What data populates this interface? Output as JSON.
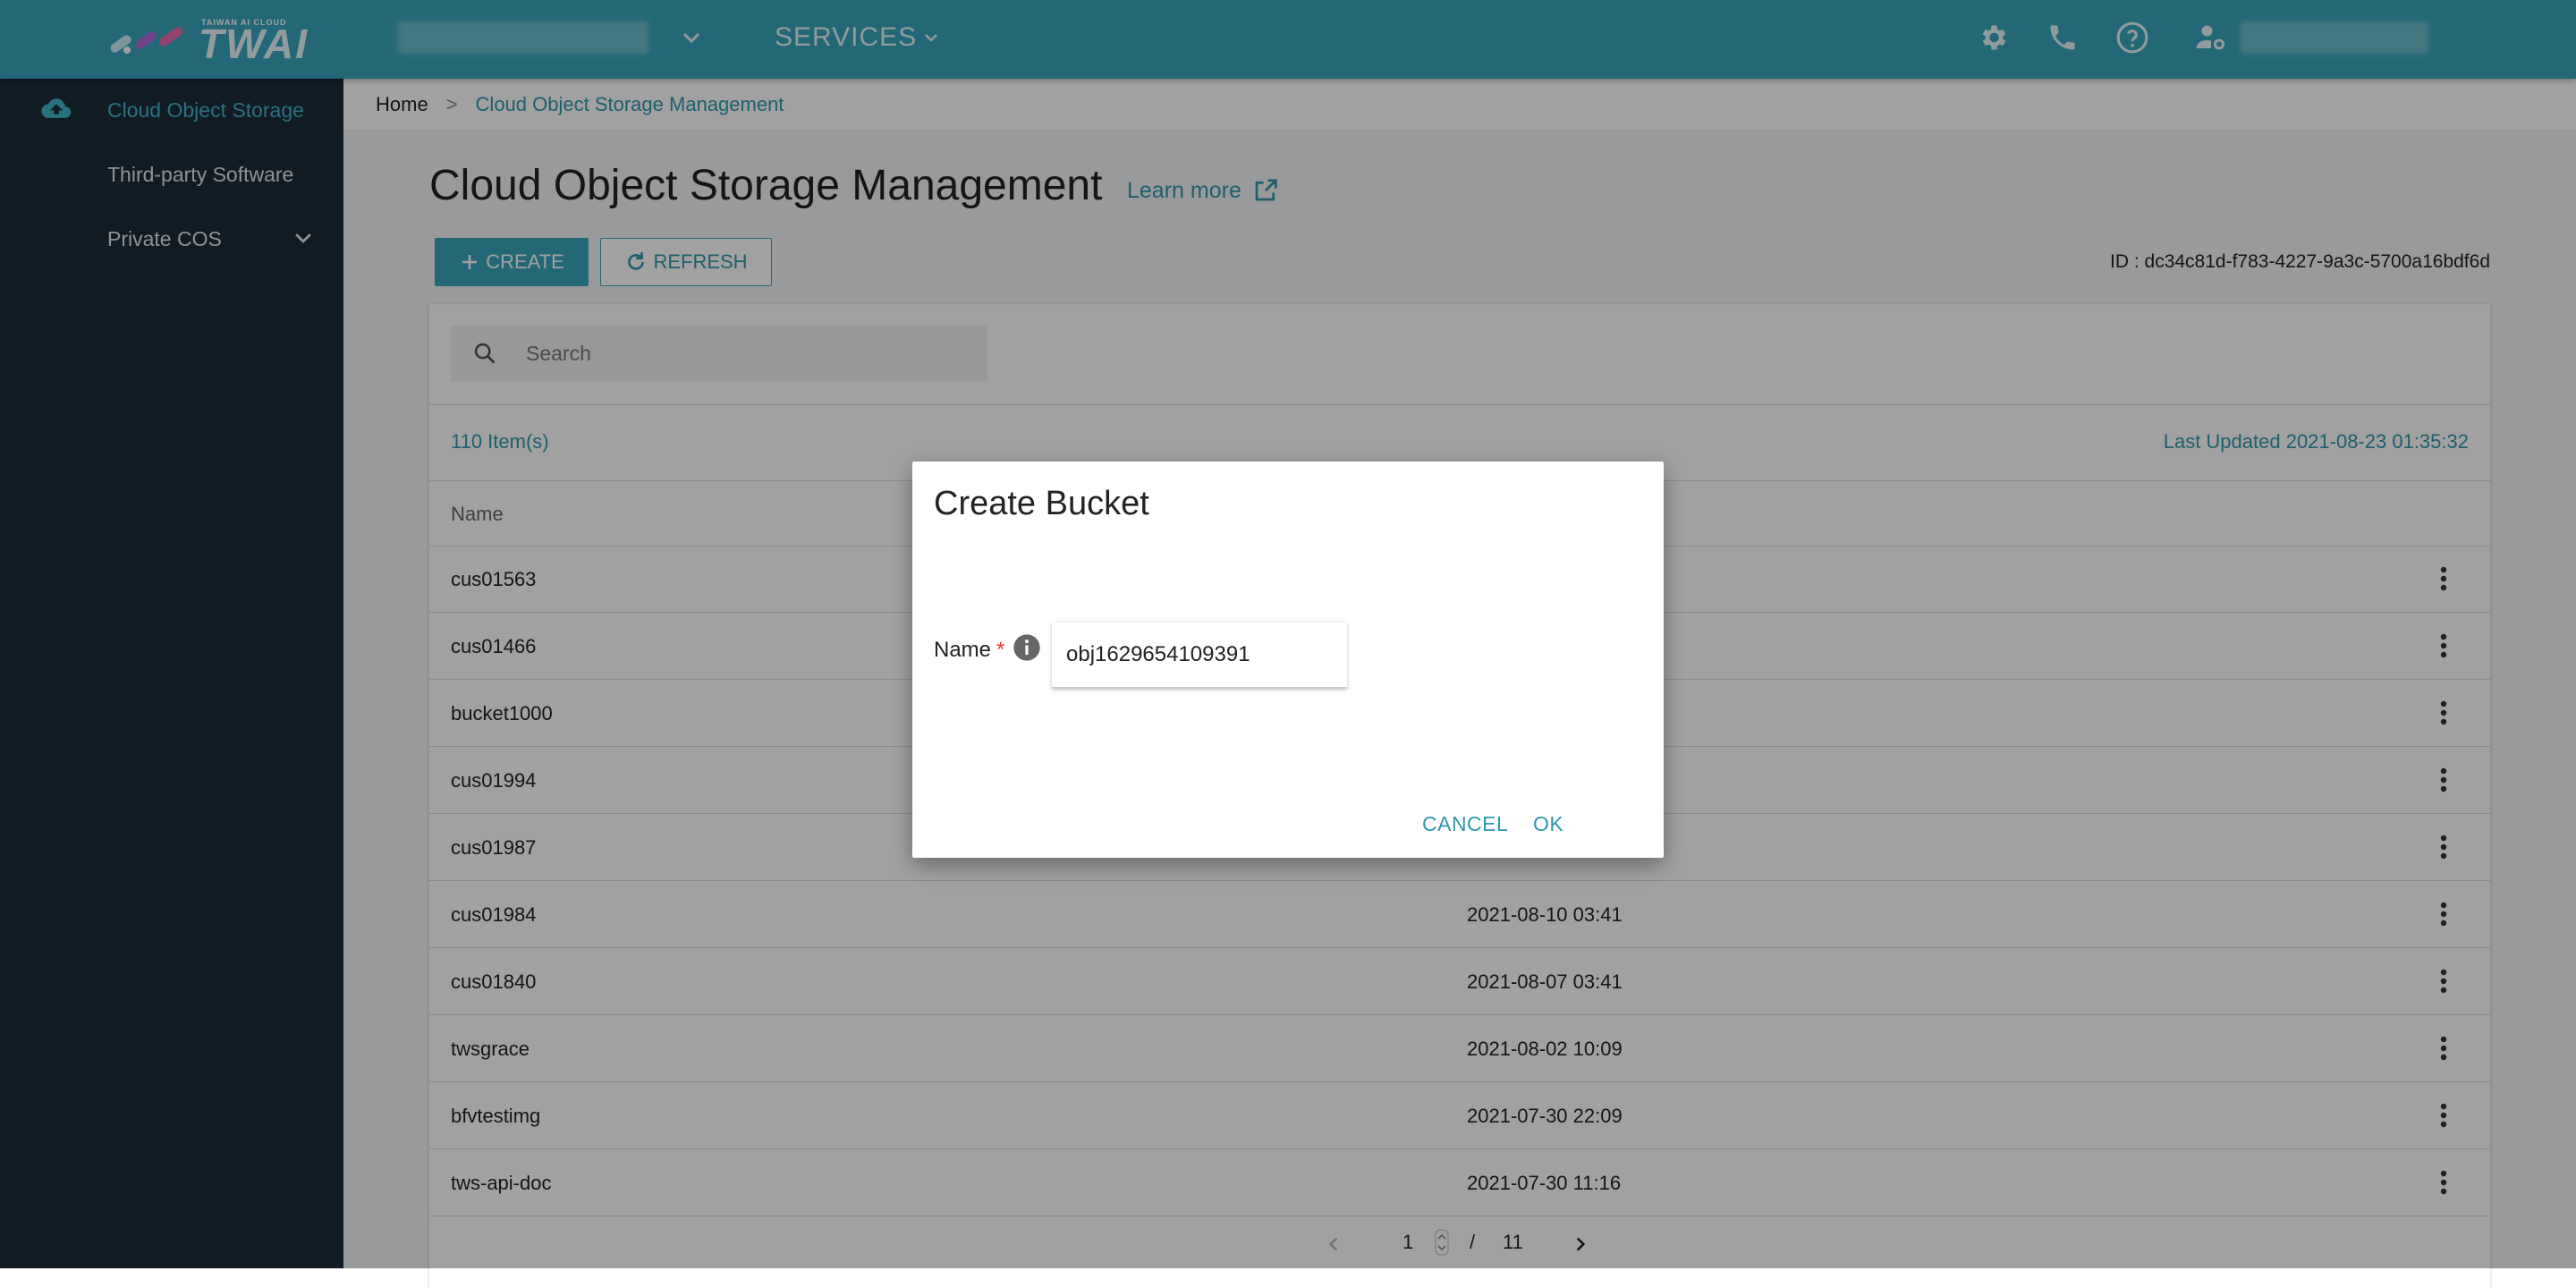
{
  "header": {
    "logo_sub": "TAIWAN AI CLOUD",
    "logo_main": "TWAI",
    "services_label": "SERVICES"
  },
  "sidebar": {
    "items": [
      {
        "label": "Cloud Object Storage",
        "active": true
      },
      {
        "label": "Third-party Software"
      },
      {
        "label": "Private COS"
      }
    ]
  },
  "breadcrumb": {
    "home": "Home",
    "separator": ">",
    "current": "Cloud Object Storage Management"
  },
  "page": {
    "title": "Cloud Object Storage Management",
    "learn_more": "Learn more",
    "create_label": "CREATE",
    "refresh_label": "REFRESH",
    "account_id": "ID : dc34c81d-f783-4227-9a3c-5700a16bdf6d"
  },
  "table": {
    "search_placeholder": "Search",
    "item_count": "110 Item(s)",
    "last_updated": "Last Updated 2021-08-23 01:35:32",
    "name_header": "Name",
    "rows": [
      {
        "name": "cus01563",
        "date": ""
      },
      {
        "name": "cus01466",
        "date": ""
      },
      {
        "name": "bucket1000",
        "date": ""
      },
      {
        "name": "cus01994",
        "date": ""
      },
      {
        "name": "cus01987",
        "date": ""
      },
      {
        "name": "cus01984",
        "date": "2021-08-10 03:41"
      },
      {
        "name": "cus01840",
        "date": "2021-08-07 03:41"
      },
      {
        "name": "twsgrace",
        "date": "2021-08-02 10:09"
      },
      {
        "name": "bfvtestimg",
        "date": "2021-07-30 22:09"
      },
      {
        "name": "tws-api-doc",
        "date": "2021-07-30 11:16"
      }
    ]
  },
  "pagination": {
    "current": "1",
    "separator": "/",
    "total": "11"
  },
  "dialog": {
    "title": "Create Bucket",
    "name_label": "Name",
    "required_mark": "*",
    "name_value": "obj1629654109391",
    "cancel_label": "CANCEL",
    "ok_label": "OK"
  },
  "colors": {
    "header": "#3aa5bd",
    "sidebar": "#1a2b3a",
    "accent": "#2f97ad"
  }
}
